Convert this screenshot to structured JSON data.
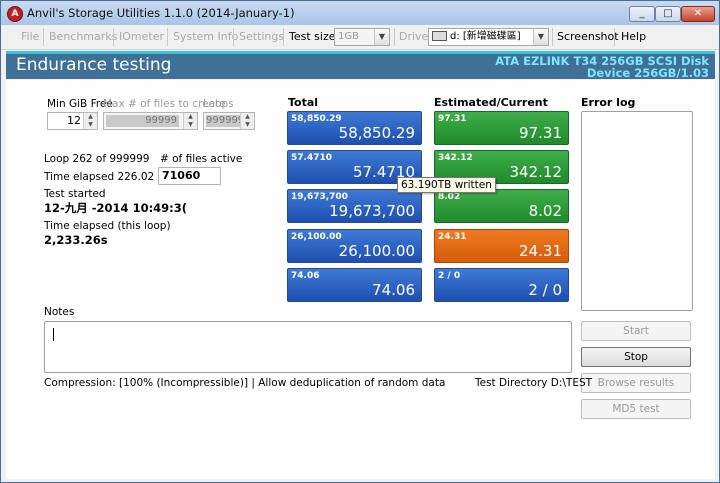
{
  "window": {
    "title": "Anvil's Storage Utilities 1.1.0 (2014-January-1)"
  },
  "menu": {
    "file": "File",
    "benchmarks": "Benchmarks",
    "iometer": "IOmeter",
    "system_info": "System Info",
    "settings": "Settings",
    "test_size_label": "Test size",
    "test_size_value": "1GB",
    "drive_label": "Drive",
    "drive_value": "d: [新增磁碟區]",
    "screenshot": "Screenshot",
    "help": "Help"
  },
  "banner": {
    "title": "Endurance testing",
    "disk": "ATA EZLINK T34 256GB SCSI Disk",
    "device": "Device 256GB/1.03"
  },
  "settings": {
    "min_gib_free_label": "Min GiB Free",
    "min_gib_free_value": "12",
    "max_files_label": "Max # of files to create",
    "max_files_value": "99999",
    "loops_label": "Loops",
    "loops_value": "999999"
  },
  "status": {
    "loop_text": "Loop 262 of 999999",
    "files_active_label": "# of files active",
    "files_active_value": "71060",
    "time_elapsed": "Time elapsed 226.02 hours",
    "test_started_label": "Test started",
    "test_started_value": "12-九月 -2014 10:49:3(",
    "time_loop_label": "Time elapsed (this loop)",
    "time_loop_value": "2,233.26s"
  },
  "columns": {
    "total": "Total",
    "estimated": "Estimated/Current",
    "error_log": "Error log"
  },
  "total_tiles": [
    {
      "small": "58,850.29",
      "big": "58,850.29"
    },
    {
      "small": "57.4710",
      "big": "57.4710"
    },
    {
      "small": "19,673,700",
      "big": "19,673,700"
    },
    {
      "small": "26,100.00",
      "big": "26,100.00"
    },
    {
      "small": "74.06",
      "big": "74.06"
    }
  ],
  "estimated_tiles": [
    {
      "small": "97.31",
      "big": "97.31",
      "color": "#2a9a3a"
    },
    {
      "small": "342.12",
      "big": "342.12",
      "color": "#2a9a3a"
    },
    {
      "small": "8.02",
      "big": "8.02",
      "color": "#2a9a3a"
    },
    {
      "small": "24.31",
      "big": "24.31",
      "color": "#e26a12"
    },
    {
      "small": "2 / 0",
      "big": "2 / 0",
      "color": "#2a5fc0"
    }
  ],
  "tooltip": "63.190TB written",
  "notes": {
    "label": "Notes",
    "value": ""
  },
  "buttons": {
    "start": "Start",
    "stop": "Stop",
    "browse": "Browse results",
    "md5": "MD5 test"
  },
  "footer": {
    "compression": "Compression: [100% (Incompressible)] | Allow deduplication of random data",
    "test_directory": "Test Directory D:\\TEST"
  },
  "colors": {
    "banner": "#3f7097",
    "banner_text": "#7fe6ff",
    "tile_blue": "#2a5fc0",
    "tile_green": "#2a9a3a",
    "tile_orange": "#e26a12"
  }
}
